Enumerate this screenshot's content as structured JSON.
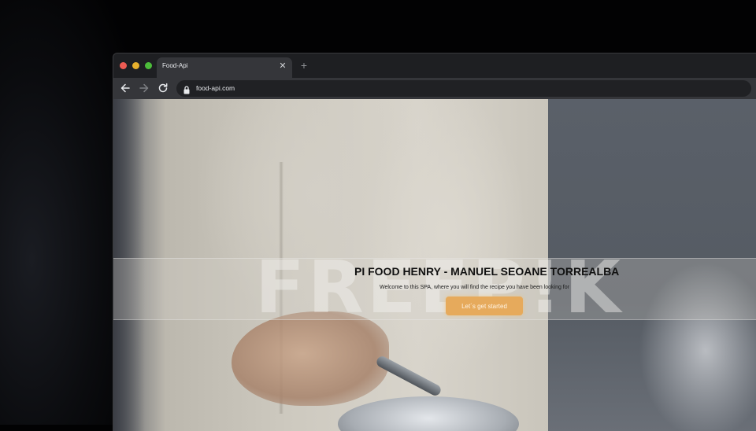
{
  "browser": {
    "tab": {
      "title": "Food-Api",
      "close_icon": "close-icon"
    },
    "new_tab_icon": "plus-icon",
    "address_bar": {
      "url": "food-api.com",
      "lock_icon": "lock-icon"
    },
    "nav_icons": [
      "arrow-left-icon",
      "arrow-right-icon",
      "reload-icon"
    ]
  },
  "page": {
    "hero": {
      "title": "PI FOOD HENRY - MANUEL SEOANE TORREALBA",
      "subtitle": "Welcome to this SPA, where you will find the recipe you have been looking for",
      "cta_label": "Let´s get started"
    },
    "watermark": "FREEP!K"
  },
  "colors": {
    "accent": "#e6aa5c",
    "chrome_dark": "#202124",
    "tab_active": "#35363a"
  }
}
